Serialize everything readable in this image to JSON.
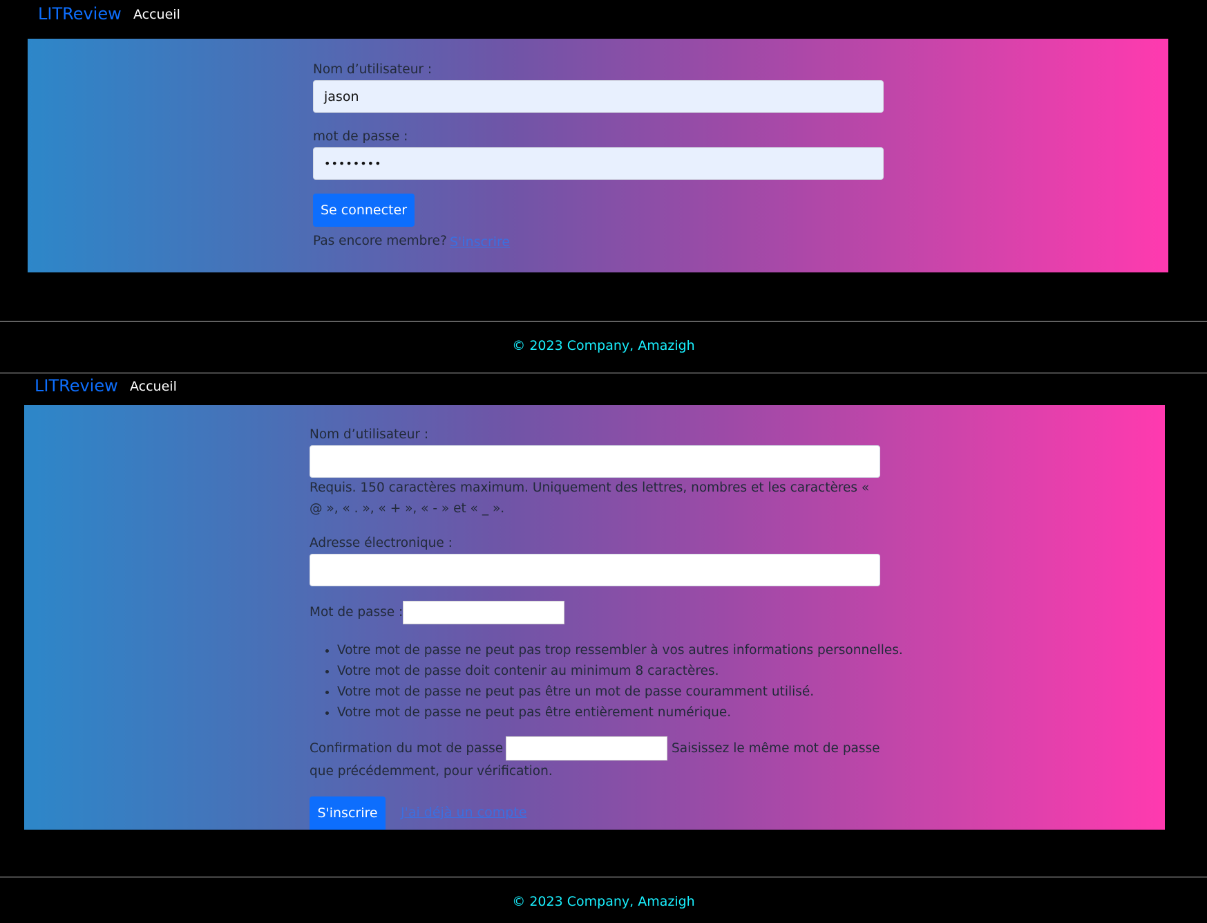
{
  "login_page": {
    "navbar": {
      "brand": "LITReview",
      "home_link": "Accueil"
    },
    "form": {
      "username_label": "Nom d’utilisateur :",
      "username_value": "jason",
      "password_label": "mot de passe :",
      "password_value": "••••••••",
      "submit_label": "Se connecter",
      "signup_prompt": "Pas encore membre?",
      "signup_link": "S'inscrire"
    },
    "footer": {
      "text": "© 2023 Company, Amazigh"
    }
  },
  "signup_page": {
    "navbar": {
      "brand": "LITReview",
      "home_link": "Accueil"
    },
    "form": {
      "username_label": "Nom d’utilisateur :",
      "username_value": "",
      "username_help": "Requis. 150 caractères maximum. Uniquement des lettres, nombres et les caractères « @ », « . », « + », « - » et « _ ».",
      "email_label": "Adresse électronique :",
      "email_value": "",
      "password_label": "Mot de passe :",
      "password_rules": [
        "Votre mot de passe ne peut pas trop ressembler à vos autres informations personnelles.",
        "Votre mot de passe doit contenir au minimum 8 caractères.",
        "Votre mot de passe ne peut pas être un mot de passe couramment utilisé.",
        "Votre mot de passe ne peut pas être entièrement numérique."
      ],
      "confirm_label": "Confirmation du mot de passe :",
      "confirm_help": "Saisissez le même mot de passe que précédemment, pour vérification.",
      "submit_label": "S'inscrire",
      "login_link": "J'ai déjà un compte"
    },
    "footer": {
      "text": "© 2023 Company, Amazigh"
    }
  },
  "colors": {
    "background": "#000000",
    "brand": "#0d6efd",
    "button": "#0d6efd",
    "footer_text": "#19f0ff",
    "gradient_start": "#2d87c9",
    "gradient_end": "#ff3aaf"
  }
}
